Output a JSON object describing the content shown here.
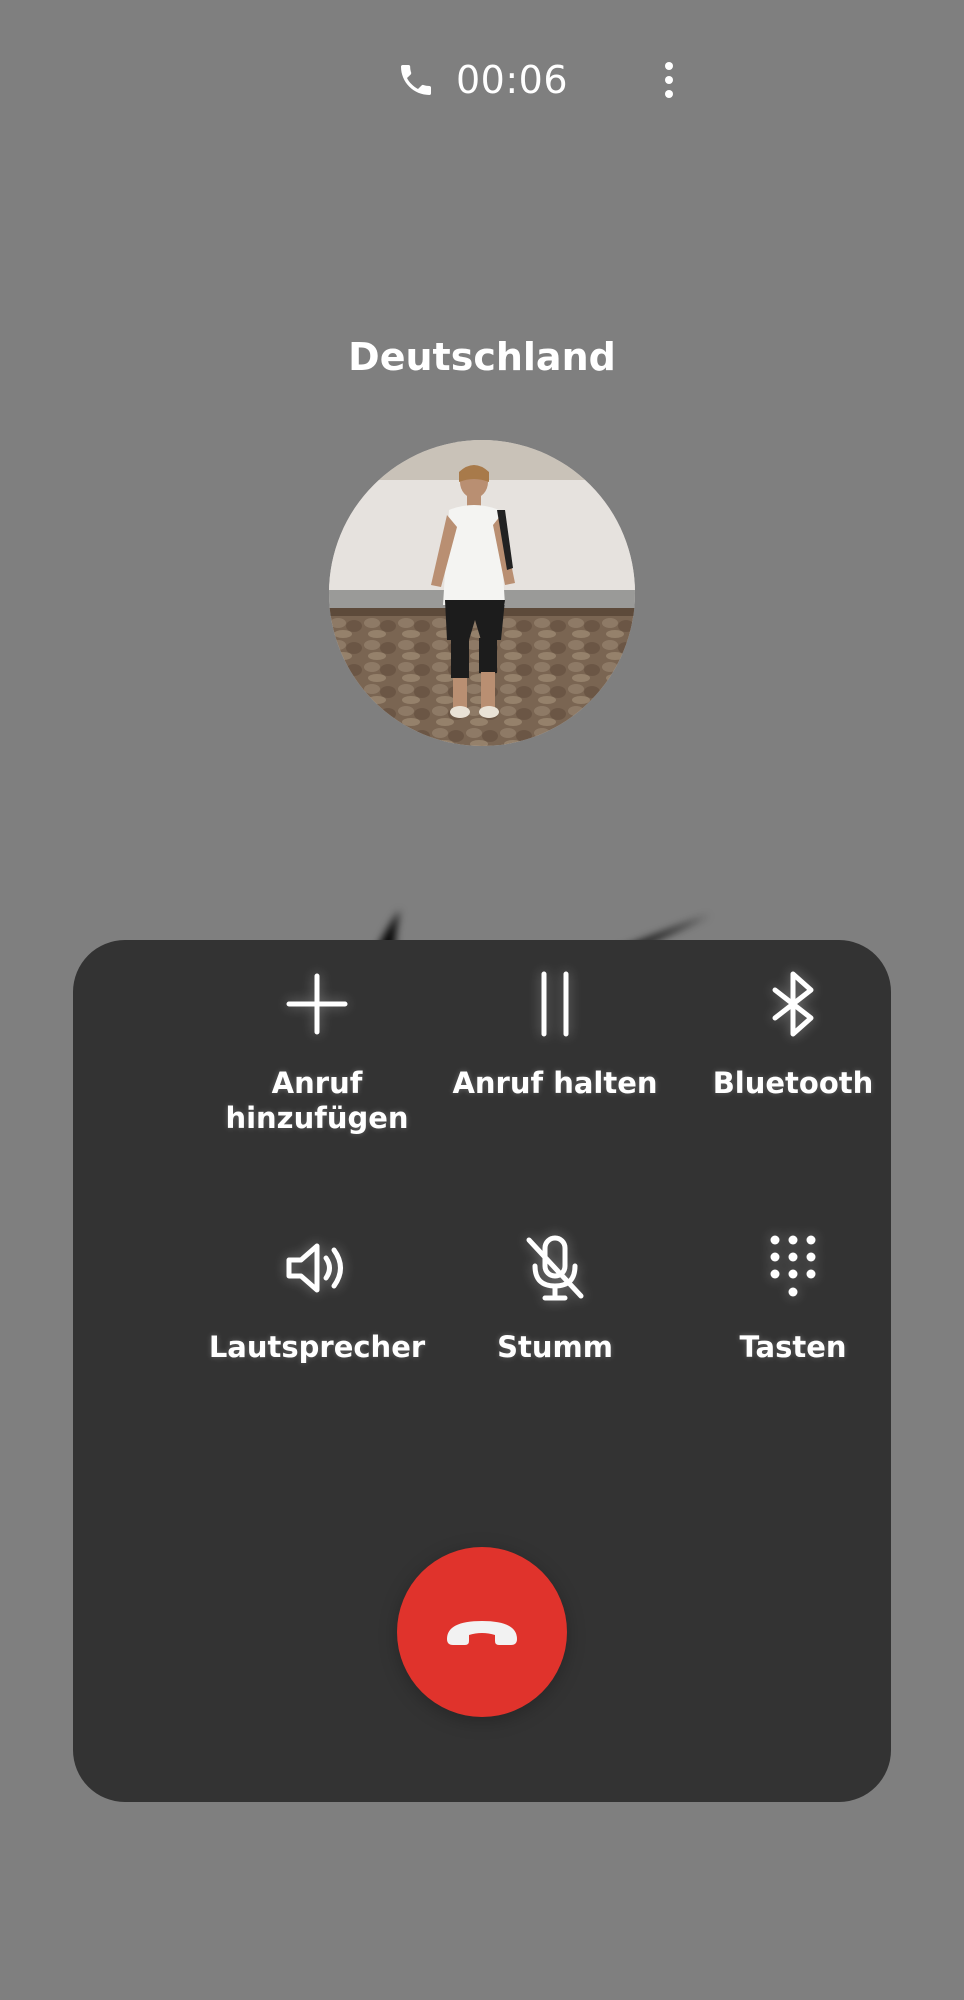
{
  "header": {
    "timer": "00:06",
    "call_icon": "phone-icon",
    "menu_icon": "more-vert-icon"
  },
  "caller": {
    "name": "Deutschland",
    "avatar_icon": "contact-photo"
  },
  "controls": [
    {
      "label": "Anruf\nhinzufügen",
      "icon": "plus-icon"
    },
    {
      "label": "Anruf halten",
      "icon": "pause-icon"
    },
    {
      "label": "Bluetooth",
      "icon": "bluetooth-icon"
    },
    {
      "label": "Lautsprecher",
      "icon": "speaker-icon"
    },
    {
      "label": "Stumm",
      "icon": "mic-off-icon"
    },
    {
      "label": "Tasten",
      "icon": "dialpad-icon"
    }
  ],
  "end_call": {
    "icon": "end-call-icon",
    "color": "#e0332c"
  },
  "colors": {
    "background": "#7f7f7f",
    "panel": "#333333",
    "text": "#ffffff"
  }
}
